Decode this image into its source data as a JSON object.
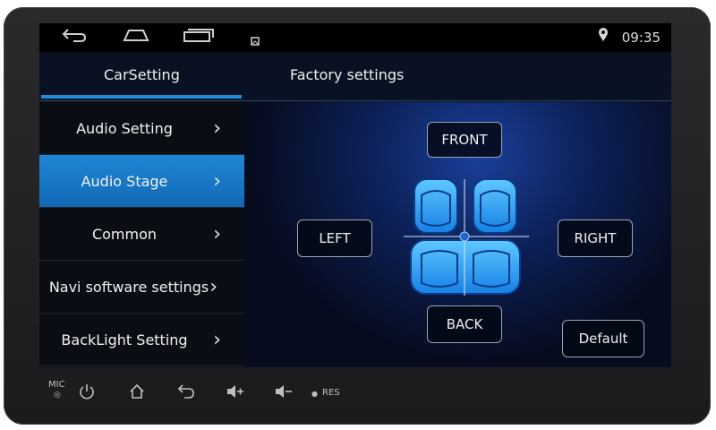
{
  "statusbar": {
    "time": "09:35",
    "icons": [
      "back-icon",
      "home-icon",
      "recent-apps-icon",
      "picture-icon",
      "location-pin-icon"
    ]
  },
  "tabs": [
    {
      "label": "CarSetting",
      "active": true
    },
    {
      "label": "Factory settings",
      "active": false
    }
  ],
  "sidebar": {
    "items": [
      {
        "label": "Audio Setting",
        "active": false
      },
      {
        "label": "Audio Stage",
        "active": true
      },
      {
        "label": "Common",
        "active": false
      },
      {
        "label": "Navi software settings",
        "active": false
      },
      {
        "label": "BackLight Setting",
        "active": false
      }
    ]
  },
  "stage": {
    "front": "FRONT",
    "back": "BACK",
    "left": "LEFT",
    "right": "RIGHT",
    "default": "Default"
  },
  "hardkeys": {
    "mic": "MIC",
    "res": "RES",
    "icons": [
      "power-icon",
      "home-icon",
      "back-icon",
      "volume-up-icon",
      "volume-down-icon"
    ]
  },
  "colors": {
    "accent": "#1a8fd8",
    "active_item": "#1e86d6",
    "seat": "#2aa8ff"
  }
}
